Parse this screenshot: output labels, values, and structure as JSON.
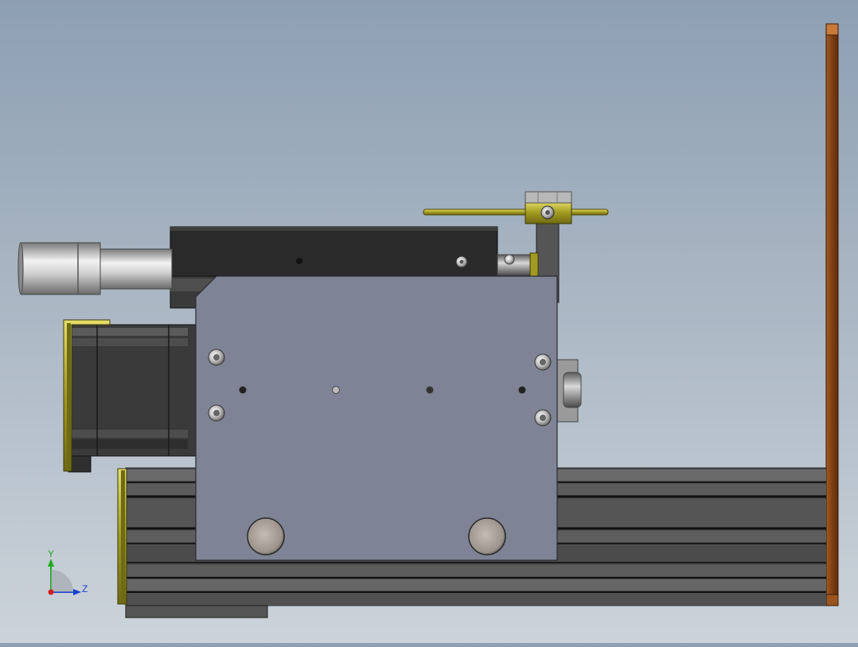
{
  "viewport": {
    "background_top": "#8d9fb3",
    "background_bottom": "#ccd3da"
  },
  "model": {
    "colors": {
      "anodized_black": "#2b2b2b",
      "extrusion_gray": "#4a4a4a",
      "carriage_plate": "#7f8596",
      "bracket_olive": "#8c8a2e",
      "copper_plate": "#8a4a1f",
      "steel": "#c8c8c8"
    }
  },
  "triad": {
    "y_label": "Y",
    "z_label": "Z",
    "y_color": "#22aa22",
    "z_color": "#1a3fd0",
    "origin_color": "#d02020"
  }
}
